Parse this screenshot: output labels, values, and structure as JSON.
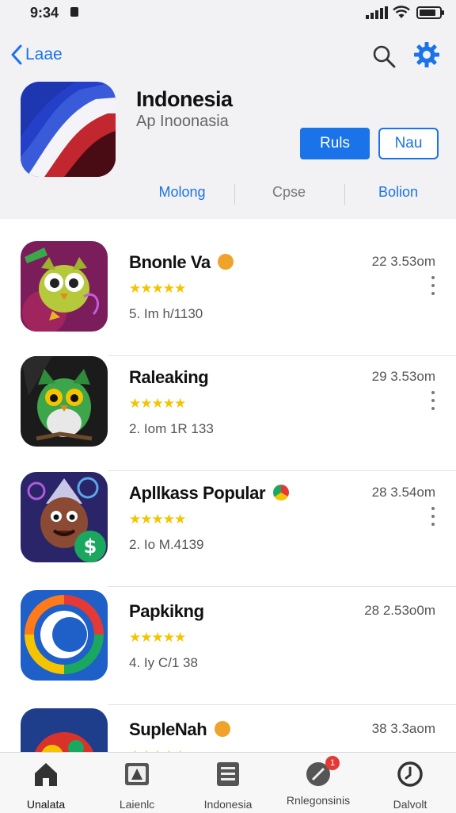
{
  "status": {
    "time": "9:34"
  },
  "header": {
    "back_label": "Laae",
    "app_title": "Indonesia",
    "app_subtitle": "Ap Inoonasia",
    "primary_button": "Ruls",
    "secondary_button": "Nau",
    "segments": [
      "Molong",
      "Cpse",
      "Bolion"
    ]
  },
  "apps": [
    {
      "title": "Bnonle Va",
      "stars": "★★★★★",
      "meta": "5. Im h/1130",
      "time": "22 3.53om"
    },
    {
      "title": "Raleaking",
      "stars": "★★★★★",
      "meta": "2. Iom 1R 133",
      "time": "29 3.53om"
    },
    {
      "title": "Apllkass Popular",
      "stars": "★★★★★",
      "meta": "2. Io M.4139",
      "time": "28 3.54om"
    },
    {
      "title": "Papkikng",
      "stars": "★★★★★",
      "meta": "4. Iy C/1 38",
      "time": "28 2.53o0m"
    },
    {
      "title": "SupleNah",
      "stars": "★★★★★",
      "meta": "",
      "time": "38 3.3aom"
    }
  ],
  "tabs": [
    {
      "label": "Unalata",
      "icon": "home-icon"
    },
    {
      "label": "Laienlc",
      "icon": "store-icon"
    },
    {
      "label": "Indonesia",
      "icon": "list-icon"
    },
    {
      "label": "Rnlegonsinis",
      "icon": "chat-icon",
      "badge": "1"
    },
    {
      "label": "Dalvolt",
      "icon": "clock-icon"
    }
  ],
  "colors": {
    "accent": "#1a73e8",
    "star": "#f5c400",
    "badge": "#e53935"
  }
}
